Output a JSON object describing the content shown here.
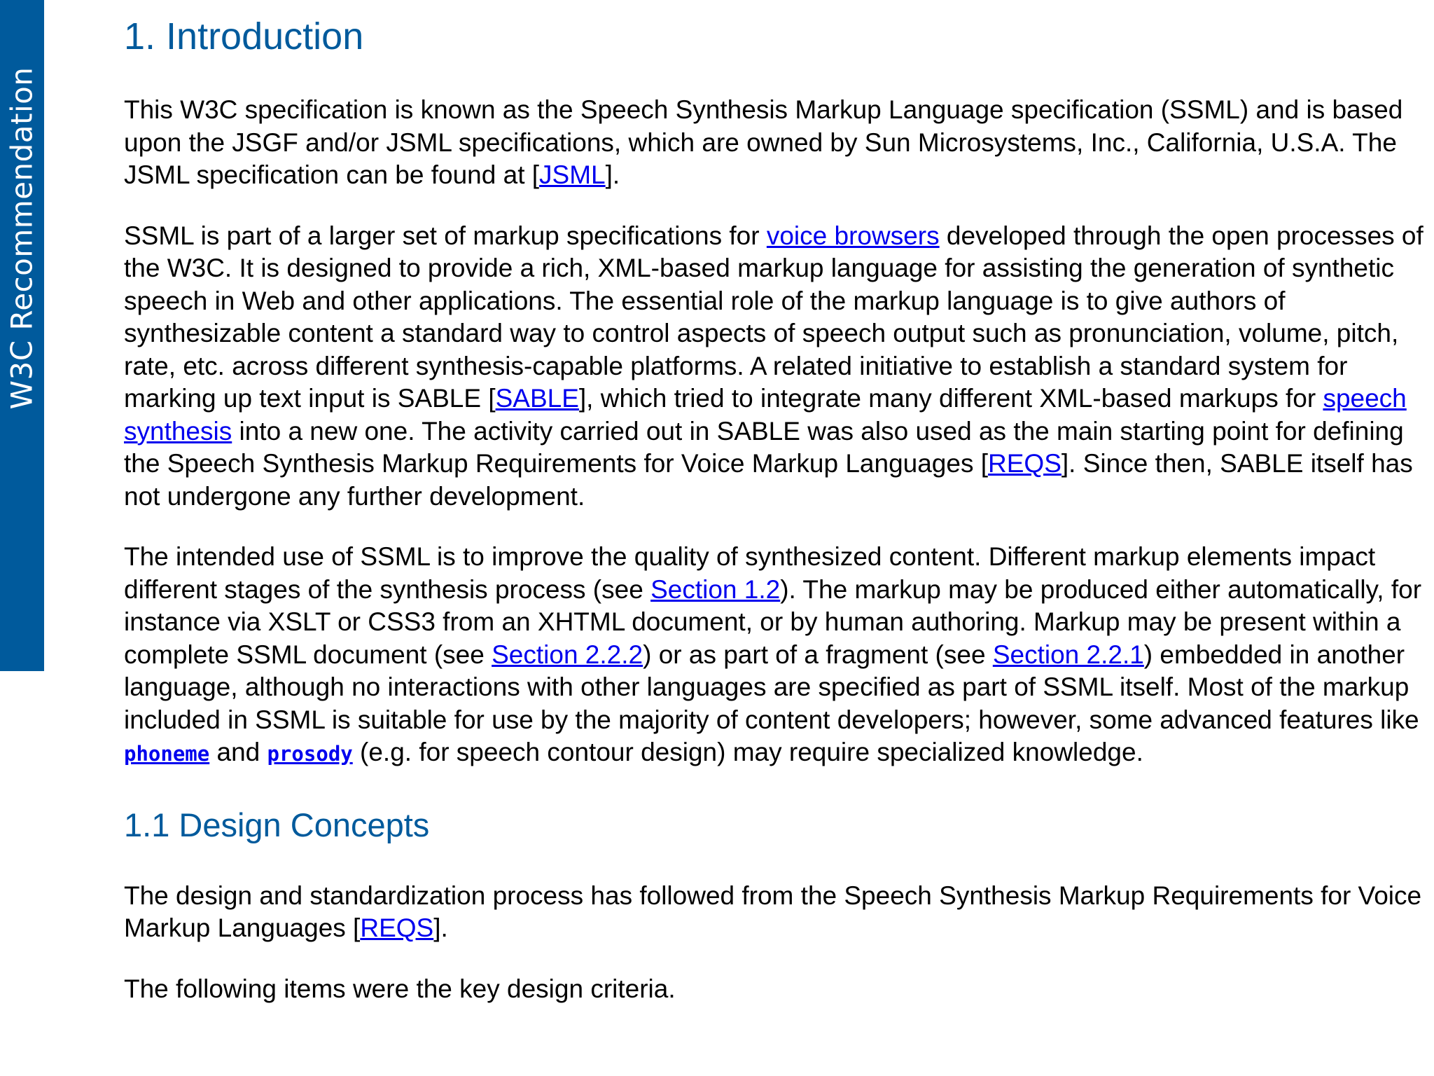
{
  "banner": {
    "text": "W3C Recommendation"
  },
  "section1": {
    "heading": "1. Introduction",
    "p1": {
      "t1": "This W3C specification is known as the Speech Synthesis Markup Language specification (SSML) and is based upon the JSGF and/or JSML specifications, which are owned by Sun Microsystems, Inc., California, U.S.A. The JSML specification can be found at [",
      "link1": "JSML",
      "t2": "]."
    },
    "p2": {
      "t1": "SSML is part of a larger set of markup specifications for ",
      "link1": "voice browsers",
      "t2": " developed through the open processes of the W3C. It is designed to provide a rich, XML-based markup language for assisting the generation of synthetic speech in Web and other applications. The essential role of the markup language is to give authors of synthesizable content a standard way to control aspects of speech output such as pronunciation, volume, pitch, rate, etc. across different synthesis-capable platforms. A related initiative to establish a standard system for marking up text input is SABLE [",
      "link2": "SABLE",
      "t3": "], which tried to integrate many different XML-based markups for ",
      "link3": "speech synthesis",
      "t4": " into a new one. The activity carried out in SABLE was also used as the main starting point for defining the Speech Synthesis Markup Requirements for Voice Markup Languages [",
      "link4": "REQS",
      "t5": "]. Since then, SABLE itself has not undergone any further development."
    },
    "p3": {
      "t1": "The intended use of SSML is to improve the quality of synthesized content. Different markup elements impact different stages of the synthesis process (see ",
      "link1": "Section 1.2",
      "t2": "). The markup may be produced either automatically, for instance via XSLT or CSS3 from an XHTML document, or by human authoring. Markup may be present within a complete SSML document (see ",
      "link2": "Section 2.2.2",
      "t3": ") or as part of a fragment (see ",
      "link3": "Section 2.2.1",
      "t4": ") embedded in another language, although no interactions with other languages are specified as part of SSML itself. Most of the markup included in SSML is suitable for use by the majority of content developers; however, some advanced features like ",
      "link4": "phoneme",
      "t5": " and ",
      "link5": "prosody",
      "t6": " (e.g. for speech contour design) may require specialized knowledge."
    }
  },
  "section1_1": {
    "heading": "1.1 Design Concepts",
    "p1": {
      "t1": "The design and standardization process has followed from the Speech Synthesis Markup Requirements for Voice Markup Languages [",
      "link1": "REQS",
      "t2": "]."
    },
    "p2": {
      "t1": "The following items were the key design criteria."
    }
  }
}
